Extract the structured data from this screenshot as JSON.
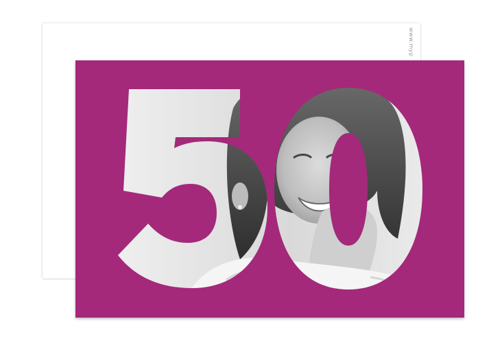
{
  "card": {
    "number": "50",
    "back_text": "www.myp",
    "colors": {
      "card_background": "#a4297a",
      "back_card": "#ffffff",
      "photo_light": "#f2f2f2",
      "photo_dark": "#3b3b3b"
    }
  }
}
